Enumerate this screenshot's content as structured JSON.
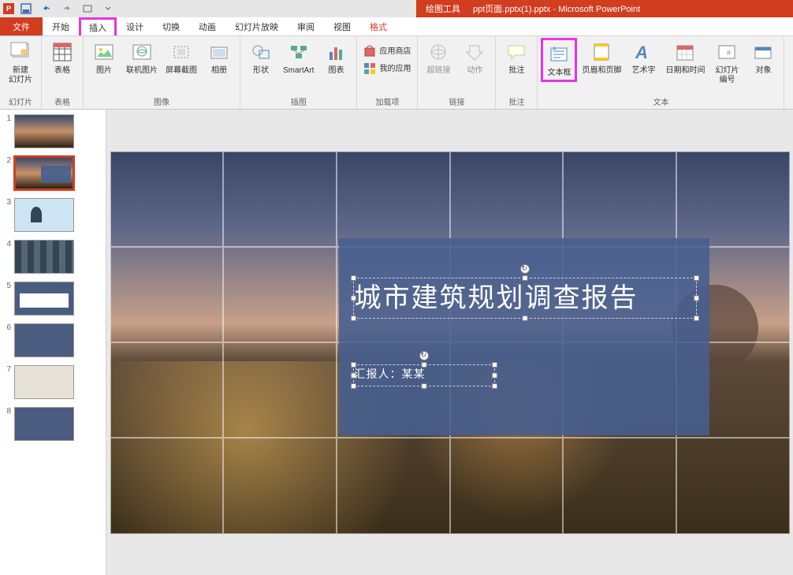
{
  "titlebar": {
    "draw_tools": "绘图工具",
    "file_name": "ppt页面.pptx(1).pptx - ",
    "app_name": "Microsoft PowerPoint"
  },
  "tabs": {
    "file": "文件",
    "home": "开始",
    "insert": "插入",
    "design": "设计",
    "transitions": "切换",
    "animations": "动画",
    "slideshow": "幻灯片放映",
    "review": "审阅",
    "view": "视图",
    "format": "格式"
  },
  "ribbon": {
    "new_slide": "新建\n幻灯片",
    "table": "表格",
    "picture": "图片",
    "online_pic": "联机图片",
    "screenshot": "屏幕截图",
    "album": "相册",
    "shape": "形状",
    "smartart": "SmartArt",
    "chart": "图表",
    "app_store": "应用商店",
    "my_apps": "我的应用",
    "hyperlink": "超链接",
    "action": "动作",
    "comment": "批注",
    "textbox": "文本框",
    "header_footer": "页眉和页脚",
    "wordart": "艺术字",
    "datetime": "日期和时间",
    "slide_number": "幻灯片\n编号",
    "object": "对象",
    "g_slides": "幻灯片",
    "g_tables": "表格",
    "g_images": "图像",
    "g_illus": "插图",
    "g_addons": "加载项",
    "g_links": "链接",
    "g_comments": "批注",
    "g_text": "文本"
  },
  "slide": {
    "title": "城市建筑规划调查报告",
    "subtitle": "汇报人：某某"
  },
  "thumbnails": [
    {
      "num": "1"
    },
    {
      "num": "2"
    },
    {
      "num": "3"
    },
    {
      "num": "4"
    },
    {
      "num": "5"
    },
    {
      "num": "6"
    },
    {
      "num": "7"
    },
    {
      "num": "8"
    }
  ]
}
